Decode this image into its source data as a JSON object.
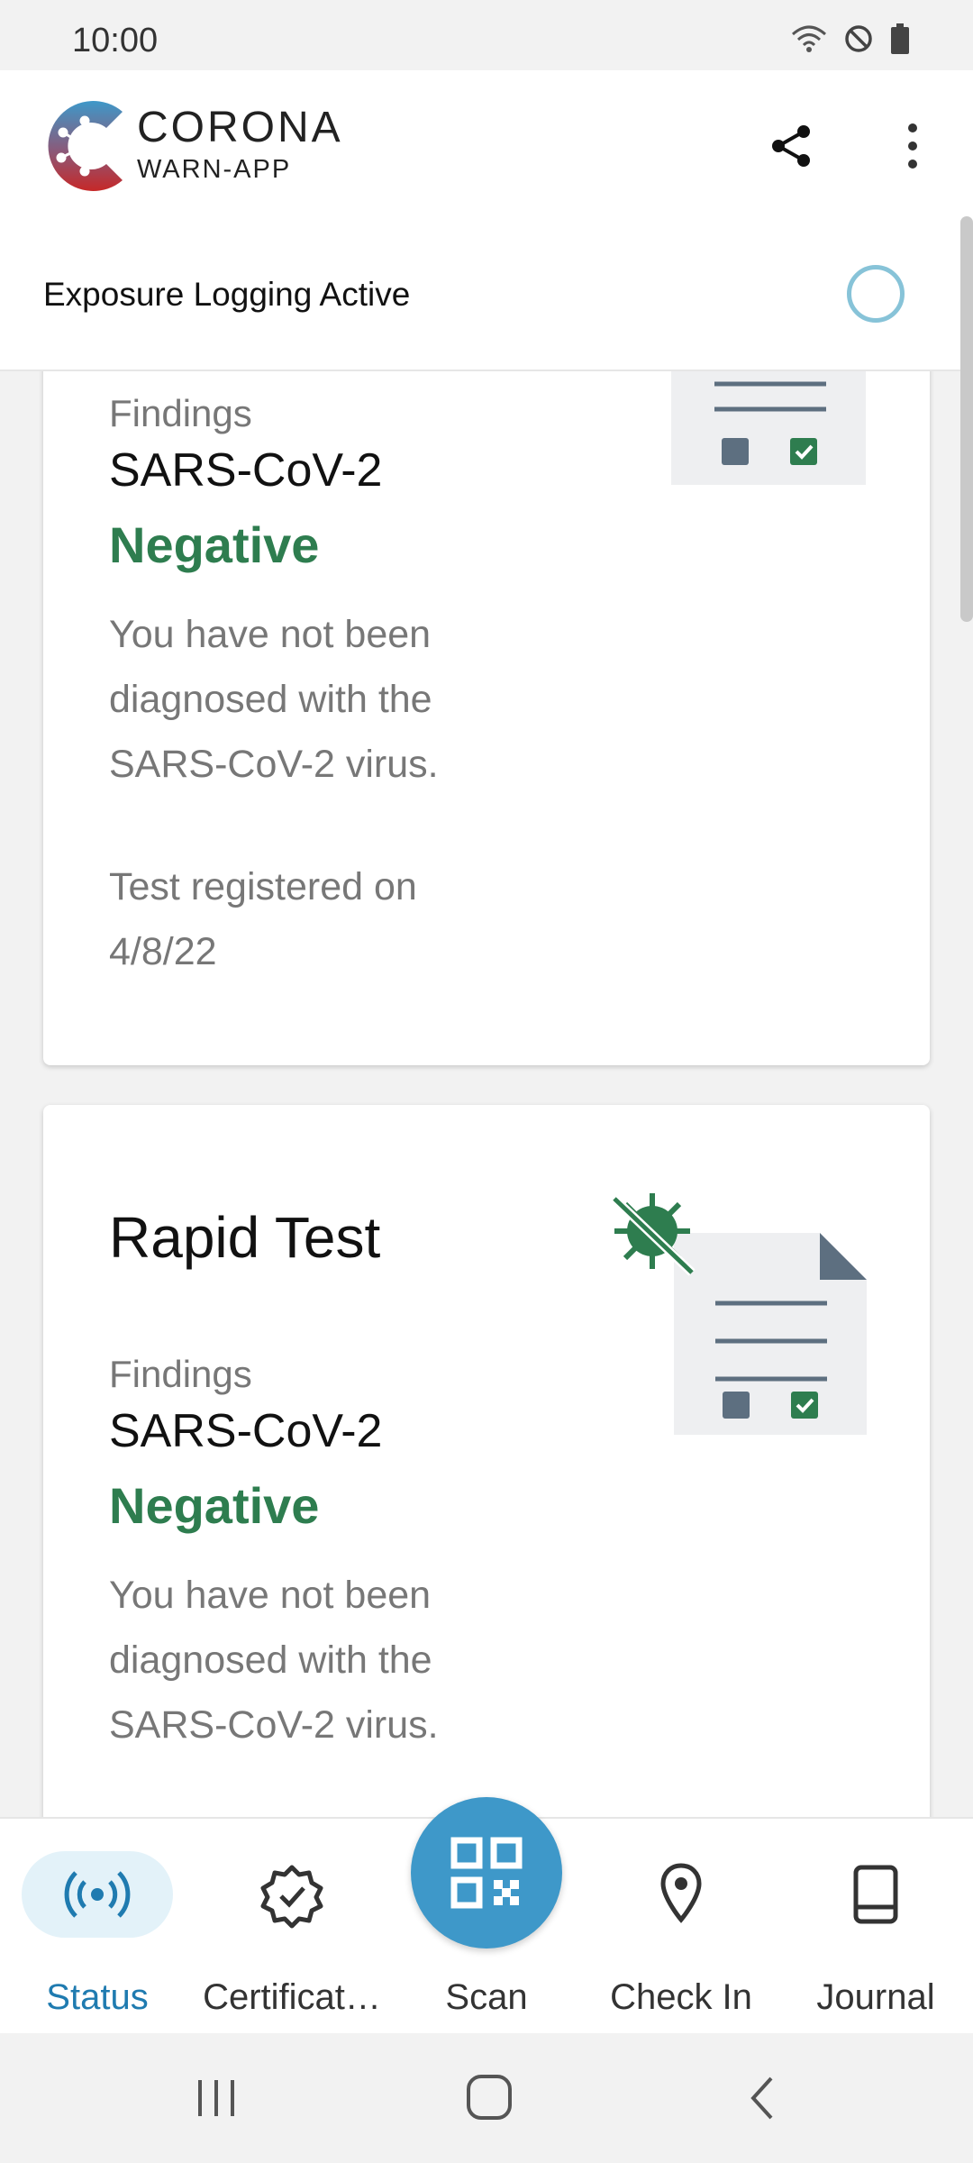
{
  "status_bar": {
    "time": "10:00"
  },
  "app": {
    "logo_line1": "CORONA",
    "logo_line2": "WARN-APP"
  },
  "exposure": {
    "label": "Exposure Logging Active"
  },
  "cards": [
    {
      "findings_label": "Findings",
      "virus": "SARS-CoV-2",
      "result": "Negative",
      "description": "You have not been diagnosed with the SARS-CoV-2 virus.",
      "registered_label": "Test registered on",
      "registered_date": "4/8/22"
    },
    {
      "title": "Rapid Test",
      "findings_label": "Findings",
      "virus": "SARS-CoV-2",
      "result": "Negative",
      "description": "You have not been diagnosed with the SARS-CoV-2 virus."
    }
  ],
  "nav": {
    "status": "Status",
    "certificates": "Certificat…",
    "scan": "Scan",
    "checkin": "Check In",
    "journal": "Journal"
  },
  "colors": {
    "accent": "#1f7bb0",
    "negative_green": "#2e7d4f",
    "fab": "#3e98c9"
  }
}
